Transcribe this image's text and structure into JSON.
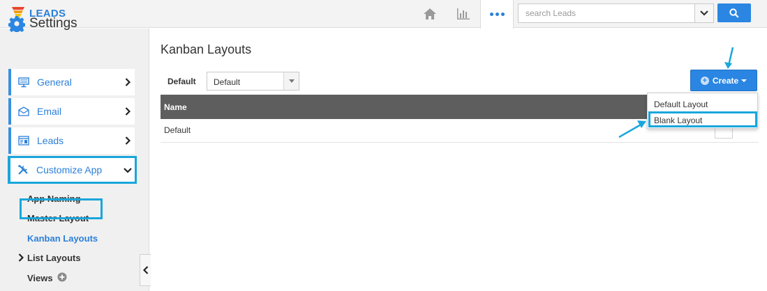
{
  "app": {
    "name": "LEADS"
  },
  "header": {
    "search": {
      "placeholder": "search Leads"
    }
  },
  "sidebar": {
    "title": "Settings",
    "menu": [
      {
        "label": "General",
        "icon": "monitor-icon"
      },
      {
        "label": "Email",
        "icon": "envelope-icon"
      },
      {
        "label": "Leads",
        "icon": "card-icon"
      },
      {
        "label": "Customize App",
        "icon": "tools-icon",
        "expanded": true
      }
    ],
    "submenu": [
      {
        "label": "App Naming"
      },
      {
        "label": "Master Layout"
      },
      {
        "label": "Kanban Layouts",
        "selected": true
      },
      {
        "label": "List Layouts",
        "has_children": true
      },
      {
        "label": "Views",
        "has_add": true
      }
    ]
  },
  "main": {
    "title": "Kanban Layouts",
    "default_label": "Default",
    "default_select_value": "Default",
    "create_label": "Create",
    "table": {
      "columns": [
        "Name"
      ],
      "rows": [
        [
          "Default"
        ]
      ]
    },
    "create_menu": [
      {
        "label": "Default Layout"
      },
      {
        "label": "Blank Layout",
        "highlighted": true
      }
    ]
  },
  "colors": {
    "accent": "#2a86e2",
    "highlight": "#19a6dc",
    "table_header": "#5e5e5e"
  }
}
